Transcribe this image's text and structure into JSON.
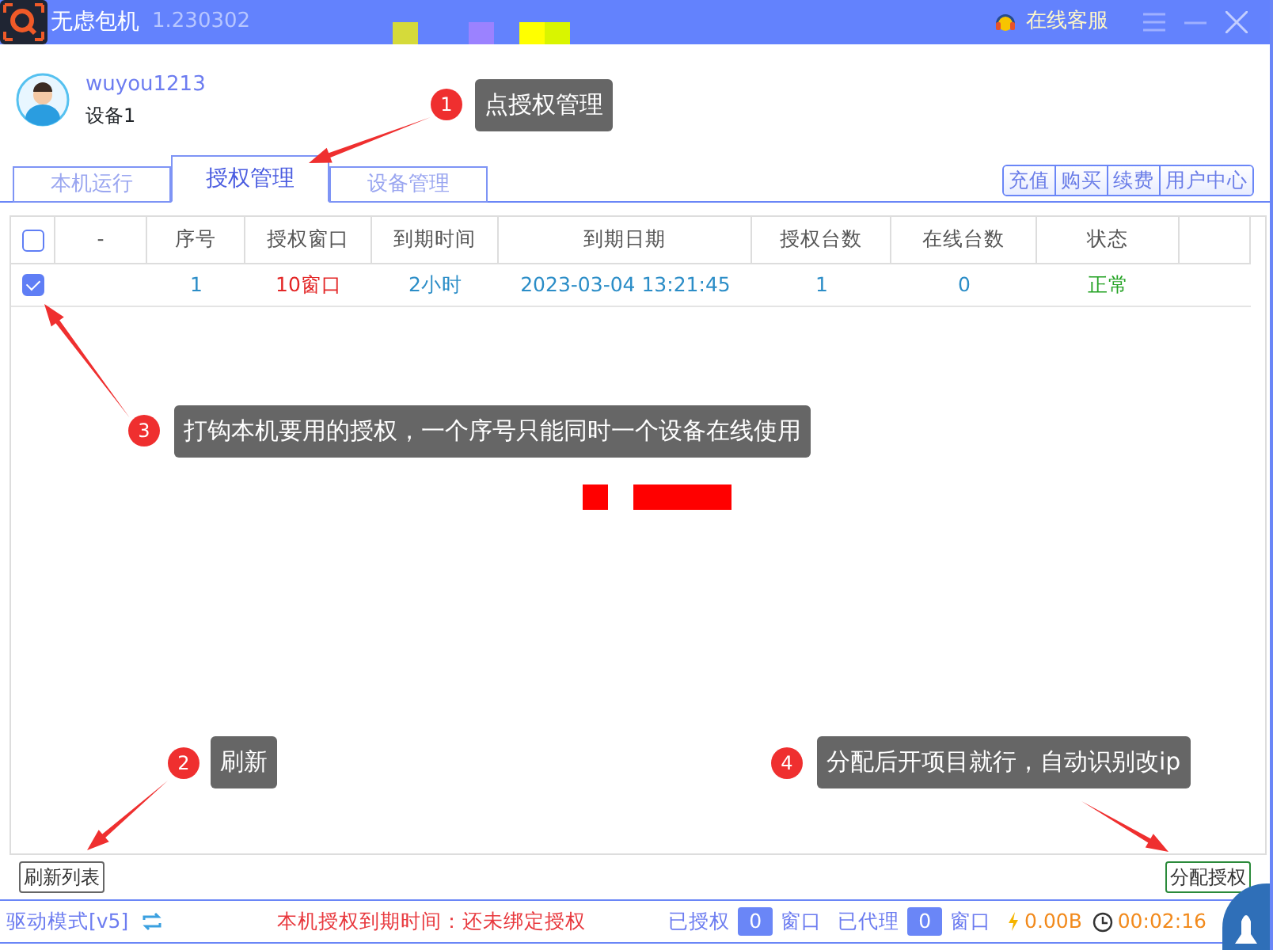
{
  "window": {
    "app_name": "无虑包机",
    "version": "1.230302",
    "service_label": "在线客服"
  },
  "user": {
    "name": "wuyou1213",
    "device": "设备1"
  },
  "tabs": [
    {
      "label": "本机运行",
      "selected": false
    },
    {
      "label": "授权管理",
      "selected": true
    },
    {
      "label": "设备管理",
      "selected": false
    }
  ],
  "actions": [
    "充值",
    "购买",
    "续费",
    "用户中心"
  ],
  "table": {
    "columns": [
      "-",
      "序号",
      "授权窗口",
      "到期时间",
      "到期日期",
      "授权台数",
      "在线台数",
      "状态"
    ],
    "header_checked": false,
    "rows": [
      {
        "checked": true,
        "cells": [
          "",
          "1",
          "10窗口",
          "2小时",
          "2023-03-04 13:21:45",
          "1",
          "0",
          "正常"
        ]
      }
    ]
  },
  "annotations": [
    {
      "number": "1",
      "text": "点授权管理"
    },
    {
      "number": "2",
      "text": "刷新"
    },
    {
      "number": "3",
      "text": "打钩本机要用的授权，一个序号只能同时一个设备在线使用"
    },
    {
      "number": "4",
      "text": "分配后开项目就行，自动识别改ip"
    }
  ],
  "buttons": {
    "refresh": "刷新列表",
    "assign": "分配授权"
  },
  "status_bar": {
    "mode": "驱动模式[v5]",
    "expiry": "本机授权到期时间：还未绑定授权",
    "authorized_label": "已授权",
    "authorized_count": "0",
    "unit_1": "窗口",
    "proxied_label": "已代理",
    "proxied_count": "0",
    "unit_2": "窗口",
    "traffic": "0.00B",
    "timer": "00:02:16"
  }
}
